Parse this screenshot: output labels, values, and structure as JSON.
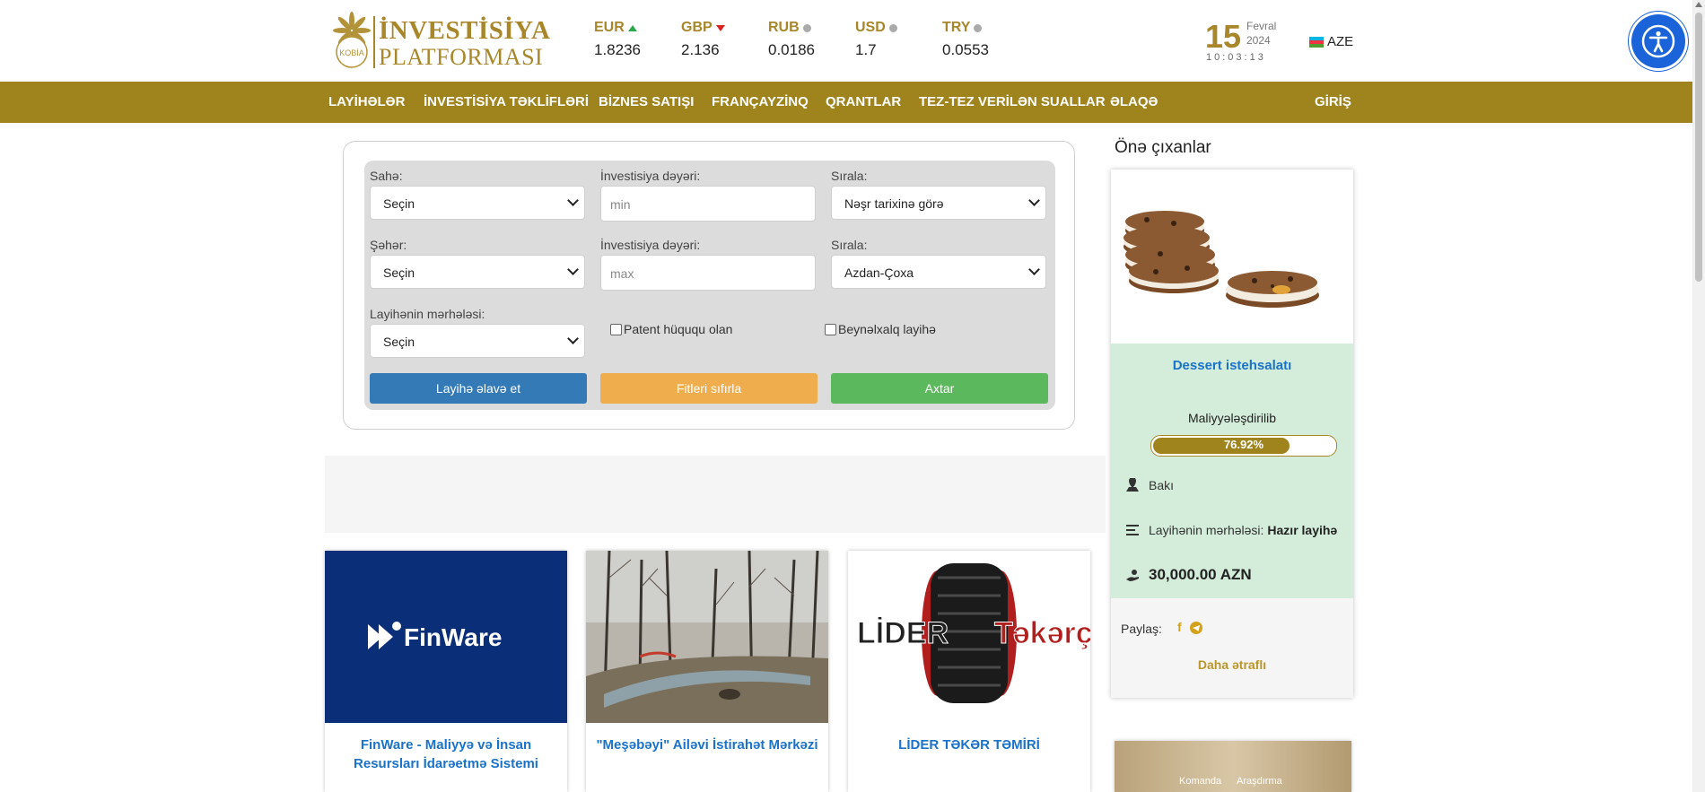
{
  "brand": {
    "line1": "İNVESTİSİYA",
    "line2": "PLATFORMASI",
    "mark": "KOBİA"
  },
  "rates": [
    {
      "code": "EUR",
      "value": "1.8236",
      "trend": "up"
    },
    {
      "code": "GBP",
      "value": "2.136",
      "trend": "down"
    },
    {
      "code": "RUB",
      "value": "0.0186",
      "trend": "flat"
    },
    {
      "code": "USD",
      "value": "1.7",
      "trend": "flat"
    },
    {
      "code": "TRY",
      "value": "0.0553",
      "trend": "flat"
    }
  ],
  "date": {
    "day": "15",
    "month": "Fevral",
    "year": "2024",
    "time": "10:03:13"
  },
  "language": "AZE",
  "nav": {
    "items": [
      "LAYİHƏLƏR",
      "İNVESTİSİYA TƏKLİFLƏRİ",
      "BİZNES SATIŞI",
      "FRANÇAYZİNQ",
      "QRANTLAR",
      "TEZ-TEZ VERİLƏN SUALLAR",
      "ƏLAQƏ"
    ],
    "login": "GİRİŞ"
  },
  "filter": {
    "field_label": "Sahə:",
    "field_value": "Seçin",
    "inv_min_label": "İnvestisiya dəyəri:",
    "inv_min_placeholder": "min",
    "sort1_label": "Sırala:",
    "sort1_value": "Nəşr tarixinə görə",
    "city_label": "Şəhər:",
    "city_value": "Seçin",
    "inv_max_label": "İnvestisiya dəyəri:",
    "inv_max_placeholder": "max",
    "sort2_label": "Sırala:",
    "sort2_value": "Azdan-Çoxa",
    "stage_label": "Layihənin mərhələsi:",
    "stage_value": "Seçin",
    "patent_label": "Patent hüququ olan",
    "intl_label": "Beynəlxalq layihə",
    "add_button": "Layihə əlavə et",
    "reset_button": "Fitleri sıfırla",
    "search_button": "Axtar"
  },
  "cards": [
    {
      "title": "FinWare - Maliyyə və İnsan Resursları İdarəetmə Sistemi",
      "logo_text": "FinWare"
    },
    {
      "title": "\"Meşəbəyi\" Ailəvi İstirahət Mərkəzi"
    },
    {
      "title": "LİDER TƏKƏR TƏMİRİ",
      "logo_left": "LİDER",
      "logo_right": "Təkərçi"
    }
  ],
  "sidebar": {
    "title": "Önə çıxanlar",
    "featured": {
      "title": "Dessert istehsalatı",
      "status": "Maliyyələşdirilib",
      "progress": 76.92,
      "progress_label": "76.92%",
      "city": "Bakı",
      "stage_label": "Layihənin mərhələsi:",
      "stage_value": "Hazır layihə",
      "amount": "30,000.00 AZN",
      "share_label": "Paylaş:",
      "more": "Daha ətraflı"
    },
    "next_labels": [
      "Komanda",
      "Araşdırma"
    ]
  },
  "colors": {
    "gold": "#9f841d",
    "blue": "#337ab7",
    "orange": "#f0ad4e",
    "green": "#5cb85c",
    "link": "#1a72c9"
  }
}
